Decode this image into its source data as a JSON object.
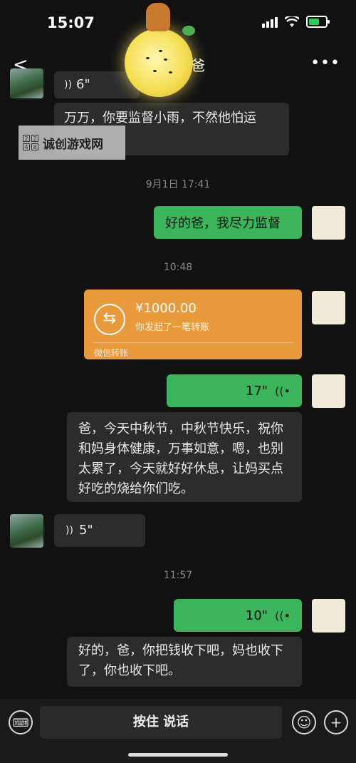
{
  "status": {
    "time": "15:07"
  },
  "header": {
    "back": "<",
    "title": "爸",
    "more": "•••"
  },
  "watermark": {
    "grid": [
      "2",
      "2",
      "4",
      "8"
    ],
    "text": "诚创游戏网"
  },
  "messages": {
    "top_voice": "6\"",
    "top_text": "万万，你要监督小雨，不然他怕运",
    "ts1": "9月1日 17:41",
    "reply1": "好的爸，我尽力监督",
    "ts2": "10:48",
    "transfer": {
      "amount": "¥1000.00",
      "desc": "你发起了一笔转账",
      "footer": "微信转账",
      "icon": "⇆"
    },
    "voice_me_1": "17\"",
    "wish_text": "爸，今天中秋节，中秋节快乐，祝你和妈身体健康，万事如意，嗯，也别太累了，今天就好好休息，让妈买点好吃的烧给你们吃。",
    "voice_dad": "5\"",
    "ts3": "11:57",
    "voice_me_2": "10\"",
    "reply_text": "好的，爸，你把钱收下吧，妈也收下了，你也收下吧。"
  },
  "bottom": {
    "hold_label": "按住 说话",
    "keyboard_icon": "⌨",
    "emoji_icon": "☺",
    "plus_icon": "+"
  },
  "colors": {
    "green_bubble": "#3bb45c",
    "transfer": "#e99a3c",
    "background": "#111111"
  }
}
